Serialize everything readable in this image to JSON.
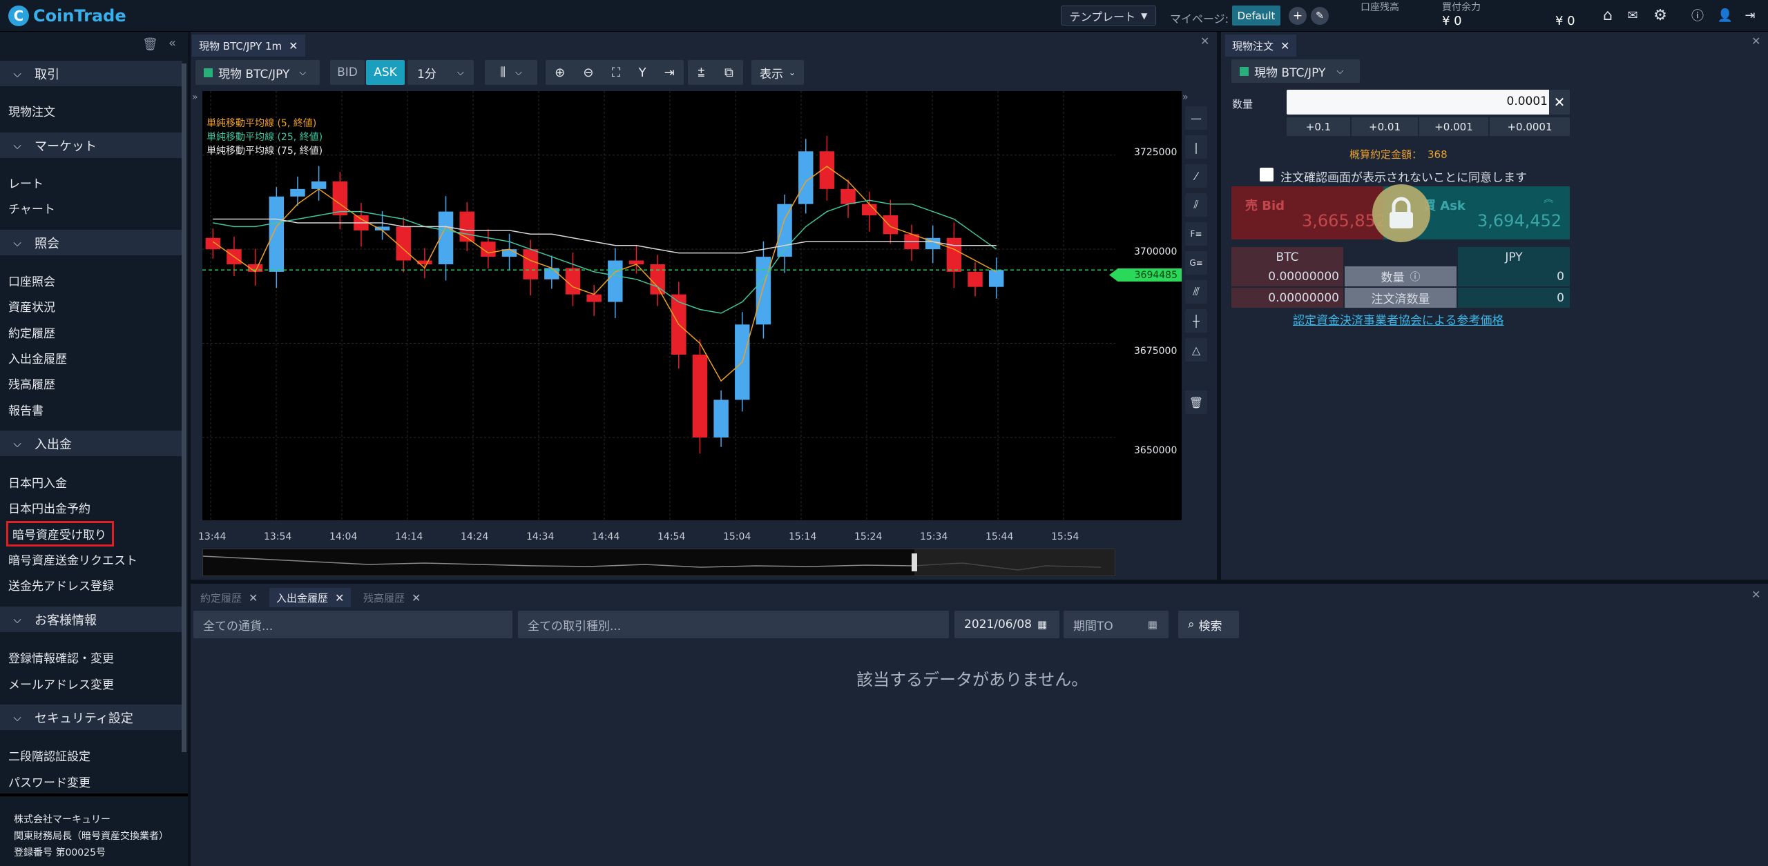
{
  "header": {
    "logo_letter": "C",
    "app_name": "CoinTrade",
    "template_label": "テンプレート",
    "mypage_label": "マイページ:",
    "mypage_value": "Default",
    "account_balance_label": "口座残高",
    "account_balance_value": "¥ 0",
    "buying_power_label": "買付余力",
    "buying_power_value": "¥ 0",
    "extra_value": "¥ 0",
    "icons": [
      "home-icon",
      "mail-icon",
      "gear-icon",
      "help-icon",
      "user-icon",
      "logout-icon"
    ]
  },
  "sidebar": {
    "sections": [
      {
        "title": "取引",
        "items": [
          "現物注文"
        ]
      },
      {
        "title": "マーケット",
        "items": [
          "レート",
          "チャート"
        ]
      },
      {
        "title": "照会",
        "items": [
          "口座照会",
          "資産状況",
          "約定履歴",
          "入出金履歴",
          "残高履歴",
          "報告書"
        ]
      },
      {
        "title": "入出金",
        "items": [
          "日本円入金",
          "日本円出金予約",
          "暗号資産受け取り",
          "暗号資産送金リクエスト",
          "送金先アドレス登録"
        ]
      },
      {
        "title": "お客様情報",
        "items": [
          "登録情報確認・変更",
          "メールアドレス変更"
        ]
      },
      {
        "title": "セキュリティ設定",
        "items": [
          "二段階認証設定",
          "パスワード変更"
        ]
      }
    ],
    "footer": [
      "株式会社マーキュリー",
      "関東財務局長（暗号資産交換業者）",
      "登録番号 第00025号"
    ]
  },
  "chart_panel": {
    "tab_label": "現物 BTC/JPY 1m",
    "symbol": "現物 BTC/JPY",
    "bid_label": "BID",
    "ask_label": "ASK",
    "interval": "1分",
    "display_label": "表示",
    "current_price": "3694485",
    "legend": [
      {
        "text": "単純移動平均線 (5, 終値)",
        "color": "#f0a020"
      },
      {
        "text": "単純移動平均線 (25, 終値)",
        "color": "#3fc6a0"
      },
      {
        "text": "単純移動平均線 (75, 終値)",
        "color": "#d8d8d8"
      }
    ]
  },
  "chart_data": {
    "type": "candlestick",
    "title": "現物 BTC/JPY 1m",
    "xlabel": "",
    "ylabel": "",
    "x_ticks": [
      "13:44",
      "13:54",
      "14:04",
      "14:14",
      "14:24",
      "14:34",
      "14:44",
      "14:54",
      "15:04",
      "15:14",
      "15:24",
      "15:34",
      "15:44",
      "15:54"
    ],
    "y_ticks": [
      3725000,
      3700000,
      3675000,
      3650000
    ],
    "ylim": [
      3628000,
      3742000
    ],
    "current_price": 3694485,
    "series": [
      {
        "name": "単純移動平均線 (5, 終値)",
        "type": "line",
        "values": [
          3702000,
          3698000,
          3694000,
          3706000,
          3712000,
          3716000,
          3712000,
          3708000,
          3705000,
          3700000,
          3695000,
          3706000,
          3703000,
          3699000,
          3700000,
          3697000,
          3695000,
          3690000,
          3688000,
          3694000,
          3696000,
          3690000,
          3680000,
          3675000,
          3665000,
          3670000,
          3690000,
          3708000,
          3718000,
          3722000,
          3718000,
          3712000,
          3706000,
          3704000,
          3702000,
          3700000,
          3697000,
          3694000
        ]
      },
      {
        "name": "単純移動平均線 (25, 終値)",
        "type": "line",
        "values": [
          3707000,
          3706000,
          3706000,
          3707000,
          3708000,
          3709000,
          3710000,
          3710000,
          3709000,
          3708000,
          3706000,
          3705000,
          3704000,
          3703000,
          3702000,
          3700000,
          3698000,
          3696000,
          3694000,
          3693000,
          3692000,
          3690000,
          3686000,
          3684000,
          3683000,
          3686000,
          3692000,
          3700000,
          3706000,
          3710000,
          3712000,
          3713000,
          3712000,
          3712000,
          3710000,
          3708000,
          3704000,
          3700000
        ]
      },
      {
        "name": "単純移動平均線 (75, 終値)",
        "type": "line",
        "values": [
          3708000,
          3708000,
          3708000,
          3708000,
          3707000,
          3707000,
          3707000,
          3707000,
          3707000,
          3706000,
          3706000,
          3706000,
          3705000,
          3705000,
          3705000,
          3704000,
          3704000,
          3703000,
          3702000,
          3701000,
          3701000,
          3700000,
          3699000,
          3699000,
          3699000,
          3699000,
          3700000,
          3701000,
          3702000,
          3702000,
          3702000,
          3702000,
          3702000,
          3702000,
          3702000,
          3701000,
          3701000,
          3701000
        ]
      }
    ],
    "candles_close": [
      3700000,
      3696000,
      3694000,
      3714000,
      3716000,
      3718000,
      3709000,
      3705000,
      3706000,
      3697000,
      3696000,
      3710000,
      3702000,
      3698000,
      3700000,
      3692000,
      3695000,
      3688000,
      3686000,
      3697000,
      3696000,
      3688000,
      3672000,
      3650000,
      3660000,
      3680000,
      3698000,
      3712000,
      3726000,
      3716000,
      3712000,
      3709000,
      3704000,
      3700000,
      3703000,
      3694000,
      3690000,
      3694485
    ]
  },
  "order_panel": {
    "tab_label": "現物注文",
    "symbol": "現物 BTC/JPY",
    "qty_label": "数量",
    "qty_value": "0.0001",
    "qty_buttons": [
      "+0.1",
      "+0.01",
      "+0.001",
      "+0.0001"
    ],
    "estimate_label": "概算約定金額：",
    "estimate_value": "368",
    "confirm_text": "注文確認画面が表示されないことに同意します",
    "bid_label": "売 Bid",
    "bid_value": "3,665,852",
    "ask_label": "買 Ask",
    "ask_value": "3,694,452",
    "table": {
      "btc_header": "BTC",
      "jpy_header": "JPY",
      "row1_label": "数量",
      "row2_label": "注文済数量",
      "btc_qty": "0.00000000",
      "btc_ordered": "0.00000000",
      "jpy_qty": "0",
      "jpy_ordered": "0"
    },
    "ref_link": "認定資金決済事業者協会による参考価格",
    "colors": {
      "bid": "#8a2025",
      "ask": "#0f6a70"
    }
  },
  "bottom_panel": {
    "tabs": [
      "約定履歴",
      "入出金履歴",
      "残高履歴"
    ],
    "currency_filter": "全ての通貨...",
    "type_filter": "全ての取引種別...",
    "date_from": "2021/06/08",
    "date_to": "期間TO",
    "search_label": "検索",
    "empty_text": "該当するデータがありません。"
  }
}
